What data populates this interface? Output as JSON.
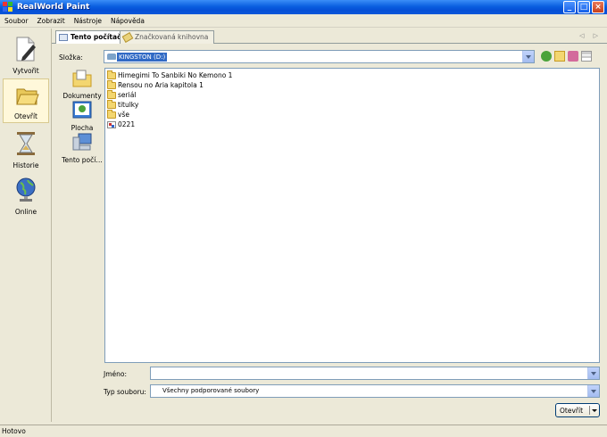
{
  "window": {
    "title": "RealWorld Paint",
    "buttons": {
      "minimize": "_",
      "maximize": "□",
      "close": "×"
    }
  },
  "menu": [
    "Soubor",
    "Zobrazit",
    "Nástroje",
    "Nápověda"
  ],
  "sidebar": {
    "items": [
      {
        "label": "Vytvořit",
        "icon": "new-document-pen-icon",
        "active": false
      },
      {
        "label": "Otevřít",
        "icon": "open-folder-icon",
        "active": true
      },
      {
        "label": "Historie",
        "icon": "hourglass-icon",
        "active": false
      },
      {
        "label": "Online",
        "icon": "globe-icon",
        "active": false
      }
    ]
  },
  "tabs": [
    {
      "label": "Tento počítač",
      "active": true
    },
    {
      "label": "Značkovaná knihovna",
      "active": false
    }
  ],
  "tab_arrows": "◁ ▷",
  "dialog": {
    "folder_label": "Složka:",
    "folder_value": "KINGSTON (D:)",
    "places": [
      {
        "label": "Dokumenty",
        "icon": "documents-icon"
      },
      {
        "label": "Plocha",
        "icon": "desktop-icon"
      },
      {
        "label": "Tento počí…",
        "icon": "computer-icon"
      }
    ],
    "files": [
      {
        "name": "Himegimi To Sanbiki No Kemono 1",
        "type": "folder"
      },
      {
        "name": "Rensou no Aria kapitola 1",
        "type": "folder"
      },
      {
        "name": "seriál",
        "type": "folder"
      },
      {
        "name": "titulky",
        "type": "folder"
      },
      {
        "name": "vše",
        "type": "folder"
      },
      {
        "name": "0221",
        "type": "image"
      }
    ],
    "name_label": "Jméno:",
    "name_value": "",
    "type_label": "Typ souboru:",
    "type_value": "Všechny podporované soubory",
    "open_button": "Otevřít"
  },
  "status": "Hotovo"
}
